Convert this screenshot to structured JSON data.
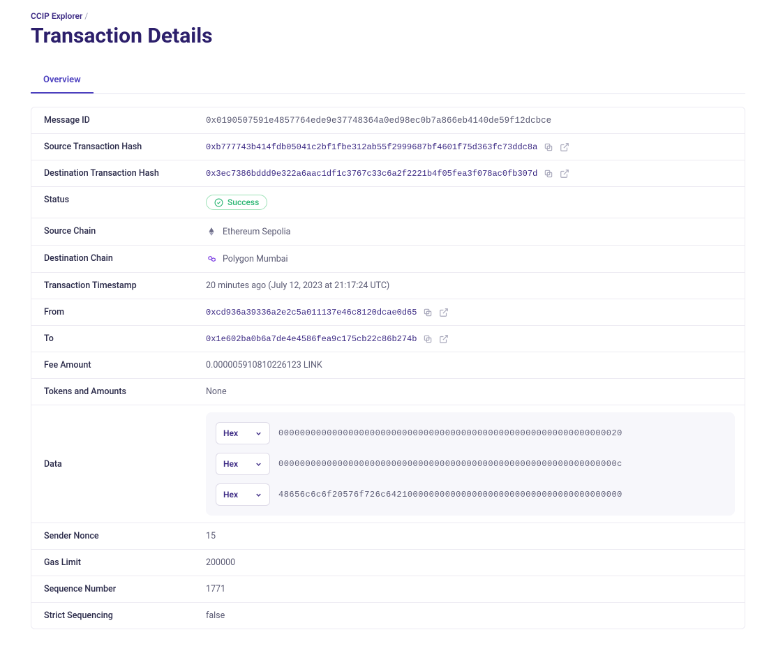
{
  "breadcrumb": {
    "root": "CCIP Explorer",
    "sep": "/"
  },
  "page_title": "Transaction Details",
  "tabs": {
    "overview": "Overview"
  },
  "rows": {
    "message_id": {
      "label": "Message ID",
      "value": "0x0190507591e4857764ede9e37748364a0ed98ec0b7a866eb4140de59f12dcbce"
    },
    "source_tx": {
      "label": "Source Transaction Hash",
      "value": "0xb777743b414fdb05041c2bf1fbe312ab55f2999687bf4601f75d363fc73ddc8a"
    },
    "dest_tx": {
      "label": "Destination Transaction Hash",
      "value": "0x3ec7386bddd9e322a6aac1df1c3767c33c6a2f2221b4f05fea3f078ac0fb307d"
    },
    "status": {
      "label": "Status",
      "value": "Success"
    },
    "source_chain": {
      "label": "Source Chain",
      "value": "Ethereum Sepolia"
    },
    "dest_chain": {
      "label": "Destination Chain",
      "value": "Polygon Mumbai"
    },
    "timestamp": {
      "label": "Transaction Timestamp",
      "value": "20 minutes ago (July 12, 2023 at 21:17:24 UTC)"
    },
    "from": {
      "label": "From",
      "value": "0xcd936a39336a2e2c5a011137e46c8120dcae0d65"
    },
    "to": {
      "label": "To",
      "value": "0x1e602ba0b6a7de4e4586fea9c175cb22c86b274b"
    },
    "fee": {
      "label": "Fee Amount",
      "value": "0.000005910810226123 LINK"
    },
    "tokens": {
      "label": "Tokens and Amounts",
      "value": "None"
    },
    "data": {
      "label": "Data"
    },
    "nonce": {
      "label": "Sender Nonce",
      "value": "15"
    },
    "gas_limit": {
      "label": "Gas Limit",
      "value": "200000"
    },
    "sequence": {
      "label": "Sequence Number",
      "value": "1771"
    },
    "strict_seq": {
      "label": "Strict Sequencing",
      "value": "false"
    }
  },
  "data_lines": [
    {
      "mode": "Hex",
      "value": "0000000000000000000000000000000000000000000000000000000000000020"
    },
    {
      "mode": "Hex",
      "value": "000000000000000000000000000000000000000000000000000000000000000c"
    },
    {
      "mode": "Hex",
      "value": "48656c6c6f20576f726c64210000000000000000000000000000000000000000"
    }
  ]
}
